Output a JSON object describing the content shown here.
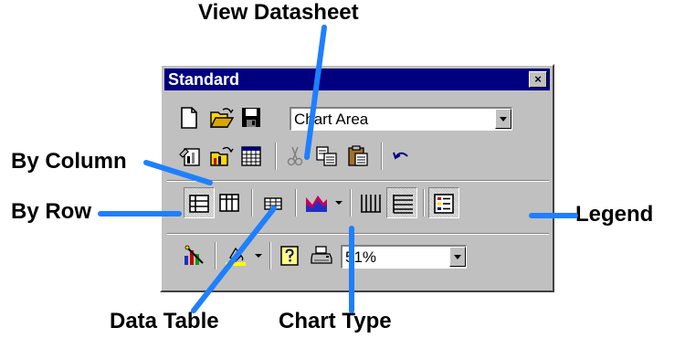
{
  "callouts": {
    "view_datasheet": "View Datasheet",
    "by_column": "By Column",
    "by_row": "By Row",
    "legend": "Legend",
    "data_table": "Data Table",
    "chart_type": "Chart Type"
  },
  "toolbar": {
    "title": "Standard",
    "close_glyph": "×",
    "chart_objects_value": "Chart Area",
    "zoom_value": "51%"
  },
  "colors": {
    "title_bar": "#000080",
    "face": "#c0c0c0",
    "leader_line": "#1e7fff"
  },
  "icons": [
    "new-icon",
    "open-icon",
    "save-icon",
    "format-chart-area-icon",
    "import-file-icon",
    "view-datasheet-icon",
    "cut-icon",
    "copy-icon",
    "paste-icon",
    "undo-icon",
    "by-row-icon",
    "by-column-icon",
    "data-table-icon",
    "chart-type-icon",
    "category-axis-gridlines-icon",
    "value-axis-gridlines-icon",
    "legend-icon",
    "chart-wizard-icon",
    "fill-color-icon",
    "help-icon",
    "print-icon"
  ]
}
